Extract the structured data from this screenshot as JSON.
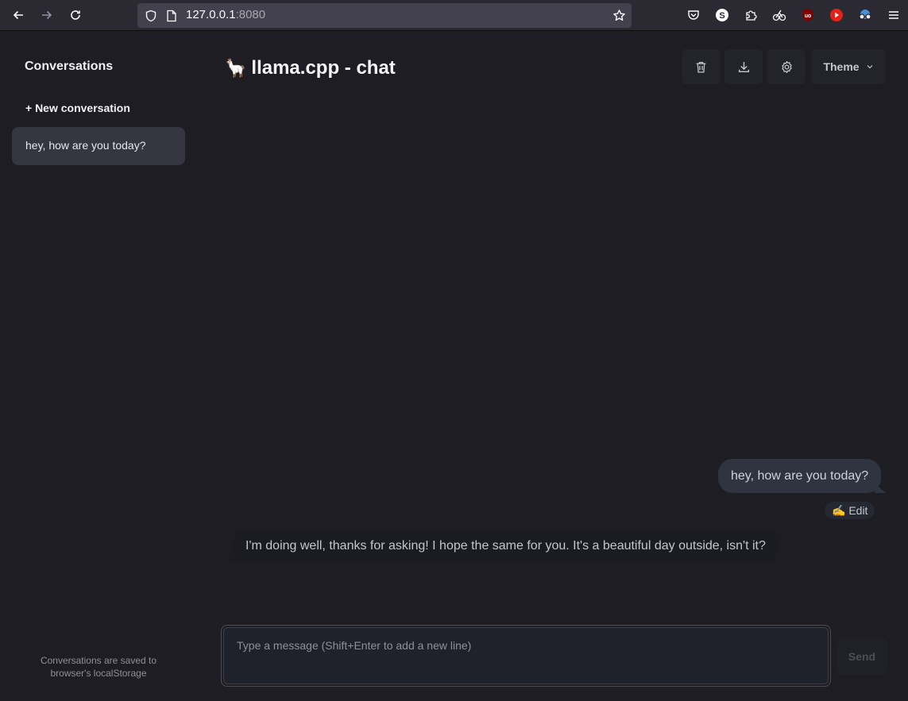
{
  "browser": {
    "url_host": "127.0.0.1",
    "url_port": ":8080",
    "icons": [
      "back-icon",
      "forward-icon",
      "reload-icon",
      "shield-icon",
      "page-icon",
      "bookmark-star-icon",
      "pocket-icon",
      "profile-s-icon",
      "extensions-icon",
      "extension-rider-icon",
      "ublock-origin-icon",
      "youtube-extension-icon",
      "glasses-extension-icon",
      "menu-icon"
    ]
  },
  "sidebar": {
    "title": "Conversations",
    "new_conversation": "+ New conversation",
    "items": [
      {
        "label": "hey, how are you today?"
      }
    ],
    "footer": "Conversations are saved to browser's localStorage"
  },
  "header": {
    "emoji": "🦙",
    "title": "llama.cpp - chat",
    "theme_label": "Theme",
    "tool_icons": [
      "trash-icon",
      "download-icon",
      "settings-gear-icon"
    ]
  },
  "messages": [
    {
      "role": "user",
      "text": "hey, how are you today?",
      "edit_label": "✍️ Edit"
    },
    {
      "role": "assistant",
      "text": "I'm doing well, thanks for asking! I hope the same for you. It's a beautiful day outside, isn't it?"
    }
  ],
  "composer": {
    "placeholder": "Type a message (Shift+Enter to add a new line)",
    "value": "",
    "send_label": "Send"
  },
  "colors": {
    "background": "#1d1d23",
    "active_conversation": "#363640",
    "user_bubble": "#2f3440",
    "assistant_bubble": "#1a1c22"
  }
}
